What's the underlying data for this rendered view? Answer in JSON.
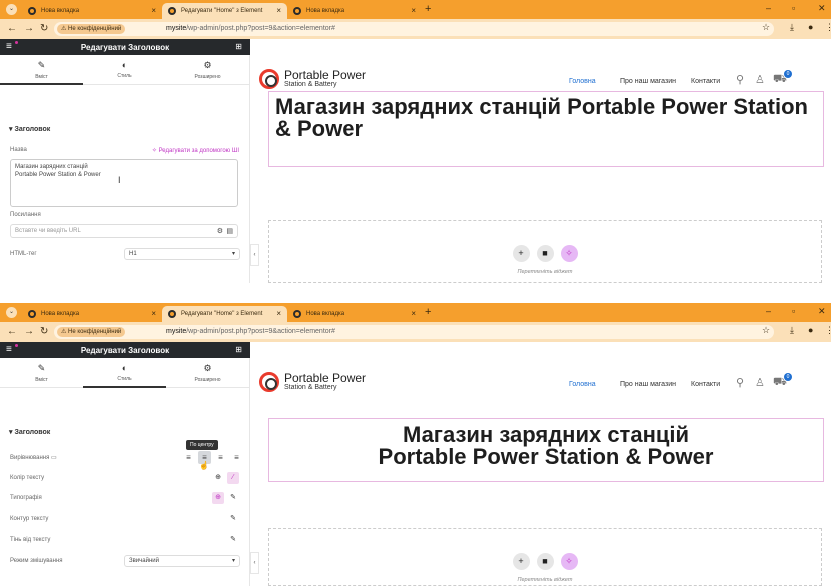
{
  "browser": {
    "tabs": [
      {
        "title": "Нова вкладка"
      },
      {
        "title": "Редагувати \"Home\" з Element"
      },
      {
        "title": "Нова вкладка"
      }
    ],
    "insecure_label": "Не конфіденційний",
    "url_host": "mysite",
    "url_path": "/wp-admin/post.php?post=9&action=elementor#",
    "colors": {
      "tab_bar": "#f59f2d",
      "toolbar": "#fbe0b8"
    }
  },
  "panel": {
    "title": "Редагувати Заголовок",
    "tabs": [
      {
        "label": "Вміст",
        "icon": "pencil-icon"
      },
      {
        "label": "Стиль",
        "icon": "half-circle-icon"
      },
      {
        "label": "Розширено",
        "icon": "gear-icon"
      }
    ],
    "content": {
      "section": "Заголовок",
      "title_label": "Назва",
      "ai_label": "Редагувати за допомогою ШІ",
      "title_value": "Магазин зарядних станцій Portable Power Station & Power",
      "link_label": "Посилання",
      "link_placeholder": "Вставте чи введіть URL",
      "html_tag_label": "HTML-тег",
      "html_tag_value": "H1"
    },
    "style": {
      "section": "Заголовок",
      "alignment_label": "Вирівнювання",
      "tooltip": "По центру",
      "text_color_label": "Колір тексту",
      "typography_label": "Типографія",
      "text_stroke_label": "Контур тексту",
      "text_shadow_label": "Тінь від тексту",
      "blend_mode_label": "Режим змішування",
      "blend_mode_value": "Звичайний"
    }
  },
  "site": {
    "logo_name": "Portable Power",
    "logo_sub": "Station & Battery",
    "menu": [
      "Головна",
      "Про наш магазин",
      "Контакти"
    ],
    "cart_count": "0",
    "heading": "Магазин зарядних станцій Portable Power Station & Power",
    "heading_line1": "Магазин зарядних станцій",
    "heading_line2": "Portable Power Station & Power",
    "drag_hint": "Перетягніть віджет",
    "accent": "#1f6fd1",
    "ai_accent": "#c036c4"
  }
}
